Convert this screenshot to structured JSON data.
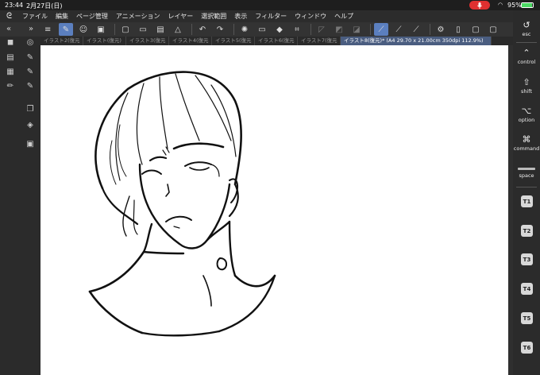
{
  "status": {
    "time": "23:44",
    "date": "2月27日(日)",
    "battery": "95%",
    "battery_level": 0.95
  },
  "menu": {
    "items": [
      "ファイル",
      "編集",
      "ページ管理",
      "アニメーション",
      "レイヤー",
      "選択範囲",
      "表示",
      "フィルター",
      "ウィンドウ",
      "ヘルプ"
    ]
  },
  "tabs": [
    "イラスト2(復元",
    "イラスト(復元)",
    "イラスト3(復元",
    "イラスト4(復元",
    "イラスト5(復元",
    "イラスト6(復元",
    "イラスト7(復元",
    "イラスト8(復元)* (A4 29.70 x 21.00cm 350dpi 112.9%)"
  ],
  "shortcuts": {
    "esc": "esc",
    "control": "control",
    "shift": "shift",
    "option": "option",
    "command": "command",
    "space": "space",
    "t1": "T1",
    "t2": "T2",
    "t3": "T3",
    "t4": "T4",
    "t5": "T5",
    "t6": "T6"
  },
  "colors": {
    "active_tool": "#5b7fbf",
    "active_tab": "#4a5d80",
    "mic": "#e03030",
    "battery": "#4cd964"
  }
}
